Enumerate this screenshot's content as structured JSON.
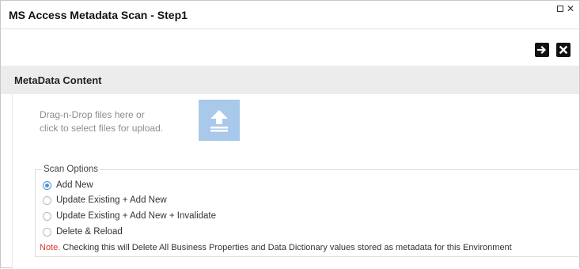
{
  "window": {
    "title": "MS Access Metadata Scan - Step1",
    "controls": {
      "minimize_icon": "square-icon",
      "close_icon": "x-icon"
    }
  },
  "toolbar": {
    "next_icon": "arrow-right-icon",
    "close_icon": "close-icon"
  },
  "section": {
    "title": "MetaData Content"
  },
  "upload": {
    "line1": "Drag-n-Drop files here or",
    "line2": "click to select files for upload.",
    "icon": "upload-icon",
    "box_color": "#a9c9ea"
  },
  "scan_options": {
    "legend": "Scan Options",
    "options": [
      {
        "label": "Add New",
        "checked": true
      },
      {
        "label": "Update Existing + Add New",
        "checked": false
      },
      {
        "label": "Update Existing + Add New + Invalidate",
        "checked": false
      },
      {
        "label": "Delete & Reload",
        "checked": false
      }
    ],
    "note_label": "Note.",
    "note_text": " Checking this will Delete All Business Properties and Data Dictionary values stored as metadata for this Environment"
  },
  "colors": {
    "accent": "#4a90d9",
    "note": "#d9362b",
    "section_bg": "#ececec"
  }
}
